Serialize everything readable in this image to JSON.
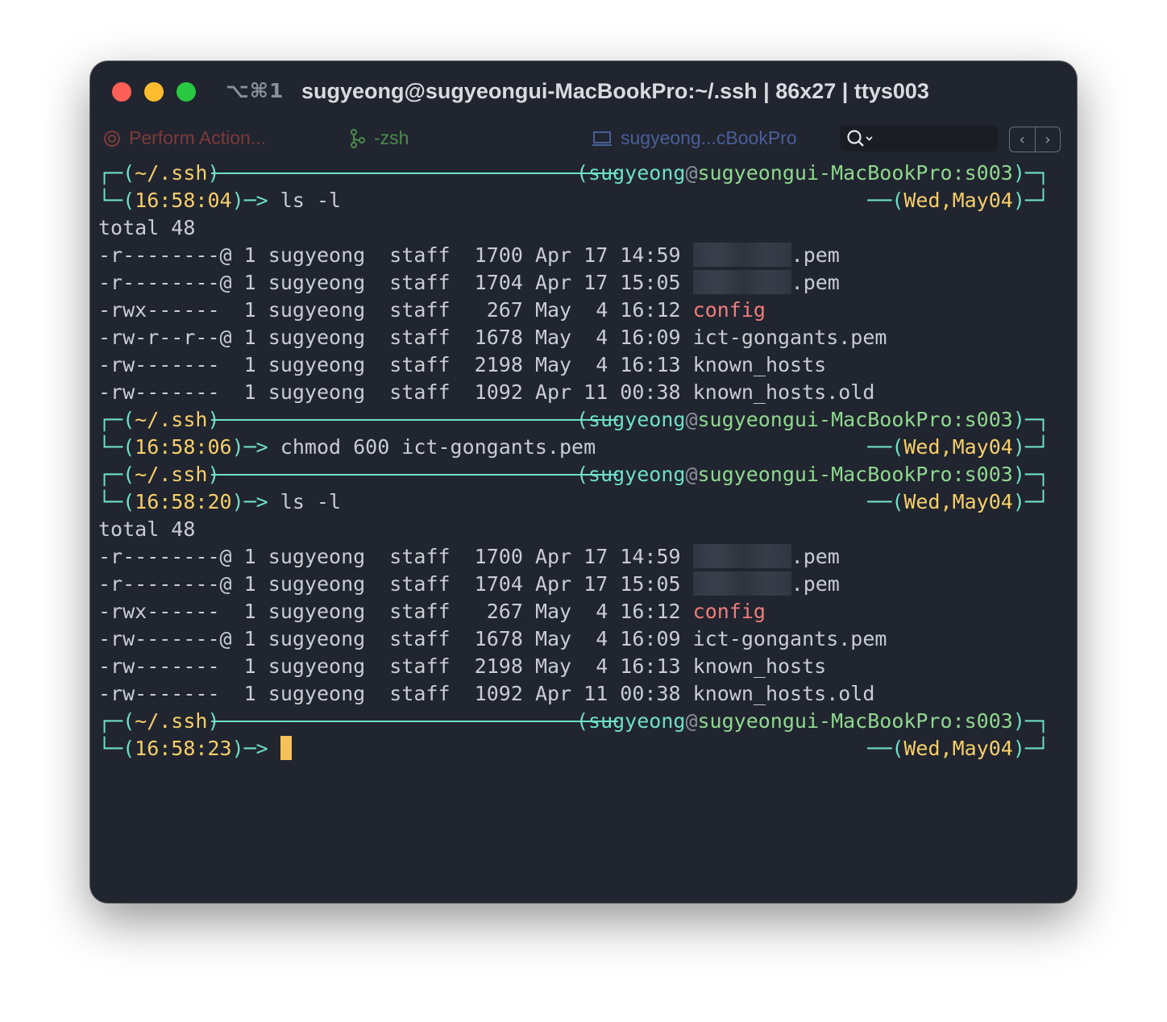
{
  "window": {
    "shortcut": "⌥⌘1",
    "title": "sugyeong@sugyeongui-MacBookPro:~/.ssh | 86x27 | ttys003"
  },
  "tabs": {
    "action": "Perform Action...",
    "shell": "-zsh",
    "host": "sugyeong...cBookPro",
    "search_placeholder": ""
  },
  "prompt": {
    "dir": "~/.ssh",
    "user": "sugyeong",
    "at": "@",
    "host": "sugyeongui-MacBookPro:s003",
    "date": "Wed,May04"
  },
  "blocks": [
    {
      "time": "16:58:04",
      "command": "ls -l",
      "output": [
        {
          "perm": "-r--------@",
          "links": "1",
          "owner": "sugyeong",
          "group": "staff",
          "size": "1700",
          "date": "Apr 17 14:59",
          "name": ".pem",
          "blurred": true
        },
        {
          "perm": "-r--------@",
          "links": "1",
          "owner": "sugyeong",
          "group": "staff",
          "size": "1704",
          "date": "Apr 17 15:05",
          "name": ".pem",
          "blurred": true
        },
        {
          "perm": "-rwx------ ",
          "links": "1",
          "owner": "sugyeong",
          "group": "staff",
          "size": " 267",
          "date": "May  4 16:12",
          "name": "config",
          "blurred": false
        },
        {
          "perm": "-rw-r--r--@",
          "links": "1",
          "owner": "sugyeong",
          "group": "staff",
          "size": "1678",
          "date": "May  4 16:09",
          "name": "ict-gongants.pem",
          "blurred": false
        },
        {
          "perm": "-rw------- ",
          "links": "1",
          "owner": "sugyeong",
          "group": "staff",
          "size": "2198",
          "date": "May  4 16:13",
          "name": "known_hosts",
          "blurred": false
        },
        {
          "perm": "-rw------- ",
          "links": "1",
          "owner": "sugyeong",
          "group": "staff",
          "size": "1092",
          "date": "Apr 11 00:38",
          "name": "known_hosts.old",
          "blurred": false
        }
      ],
      "total": "total 48"
    },
    {
      "time": "16:58:06",
      "command": "chmod 600 ict-gongants.pem"
    },
    {
      "time": "16:58:20",
      "command": "ls -l",
      "total": "total 48",
      "output": [
        {
          "perm": "-r--------@",
          "links": "1",
          "owner": "sugyeong",
          "group": "staff",
          "size": "1700",
          "date": "Apr 17 14:59",
          "name": ".pem",
          "blurred": true
        },
        {
          "perm": "-r--------@",
          "links": "1",
          "owner": "sugyeong",
          "group": "staff",
          "size": "1704",
          "date": "Apr 17 15:05",
          "name": ".pem",
          "blurred": true
        },
        {
          "perm": "-rwx------ ",
          "links": "1",
          "owner": "sugyeong",
          "group": "staff",
          "size": " 267",
          "date": "May  4 16:12",
          "name": "config",
          "blurred": false
        },
        {
          "perm": "-rw-------@",
          "links": "1",
          "owner": "sugyeong",
          "group": "staff",
          "size": "1678",
          "date": "May  4 16:09",
          "name": "ict-gongants.pem",
          "blurred": false
        },
        {
          "perm": "-rw------- ",
          "links": "1",
          "owner": "sugyeong",
          "group": "staff",
          "size": "2198",
          "date": "May  4 16:13",
          "name": "known_hosts",
          "blurred": false
        },
        {
          "perm": "-rw------- ",
          "links": "1",
          "owner": "sugyeong",
          "group": "staff",
          "size": "1092",
          "date": "Apr 11 00:38",
          "name": "known_hosts.old",
          "blurred": false
        }
      ]
    },
    {
      "time": "16:58:23",
      "command": ""
    }
  ],
  "colors": {
    "background": "#21252f",
    "prompt_cyan": "#6ee0c8",
    "prompt_yellow": "#f7cf6a",
    "prompt_green": "#8fd88f",
    "config_red": "#f07c7c",
    "cursor": "#f7c15a"
  }
}
